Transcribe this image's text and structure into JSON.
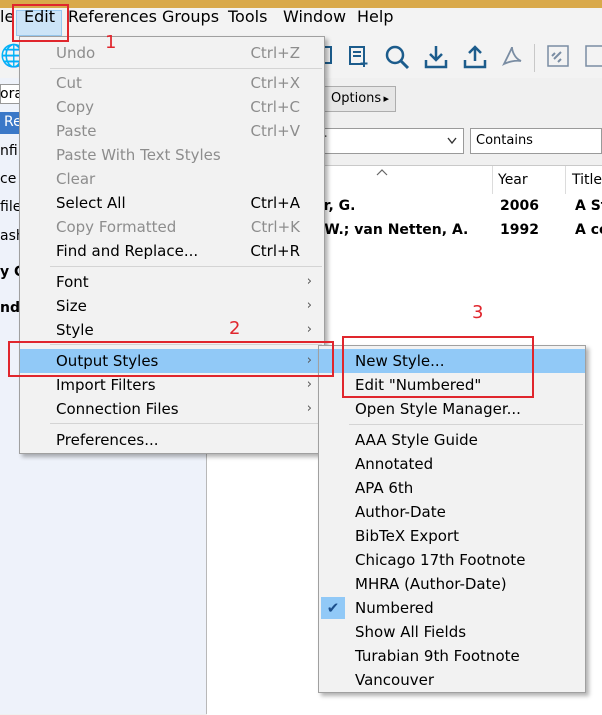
{
  "menubar": {
    "items": [
      "le",
      "Edit",
      "References",
      "Groups",
      "Tools",
      "Window",
      "Help"
    ]
  },
  "toolbar": {
    "icons": [
      "globe-icon",
      "copy-icon",
      "new-reference-icon",
      "online-search-icon",
      "import-icon",
      "export-icon",
      "pdf-icon",
      "link-icon",
      "share-icon"
    ]
  },
  "left_panel": {
    "fragments": [
      "ora",
      "Re",
      "nfi",
      "ce",
      "file",
      "ash",
      "y G",
      "nd"
    ]
  },
  "search": {
    "options_label": "Options",
    "options_arrow": "▸",
    "field_fragment": "r",
    "match_mode": "Contains"
  },
  "grid": {
    "headers": [
      "Year",
      "Title"
    ],
    "rows": [
      {
        "author": "or, G.",
        "year": "2006",
        "title": "A St"
      },
      {
        "author": ", W.; van Netten, A.",
        "year": "1992",
        "title": "A co"
      }
    ]
  },
  "edit_menu": {
    "items": [
      {
        "label": "Undo",
        "shortcut": "Ctrl+Z",
        "disabled": true
      },
      {
        "label": "Cut",
        "shortcut": "Ctrl+X",
        "disabled": true
      },
      {
        "label": "Copy",
        "shortcut": "Ctrl+C",
        "disabled": true
      },
      {
        "label": "Paste",
        "shortcut": "Ctrl+V",
        "disabled": true
      },
      {
        "label": "Paste With Text Styles",
        "shortcut": "",
        "disabled": true
      },
      {
        "label": "Clear",
        "shortcut": "",
        "disabled": true
      },
      {
        "label": "Select All",
        "shortcut": "Ctrl+A",
        "disabled": false
      },
      {
        "label": "Copy Formatted",
        "shortcut": "Ctrl+K",
        "disabled": true
      },
      {
        "label": "Find and Replace...",
        "shortcut": "Ctrl+R",
        "disabled": false
      },
      {
        "label": "Font",
        "shortcut": "",
        "disabled": false
      },
      {
        "label": "Size",
        "shortcut": "",
        "disabled": false
      },
      {
        "label": "Style",
        "shortcut": "",
        "disabled": false
      },
      {
        "label": "Output Styles",
        "shortcut": "",
        "disabled": false
      },
      {
        "label": "Import Filters",
        "shortcut": "",
        "disabled": false
      },
      {
        "label": "Connection Files",
        "shortcut": "",
        "disabled": false
      },
      {
        "label": "Preferences...",
        "shortcut": "",
        "disabled": false
      }
    ],
    "submenu_arrow": "›"
  },
  "styles_menu": {
    "items": [
      "New Style...",
      "Edit \"Numbered\"",
      "Open Style Manager...",
      "AAA Style Guide",
      "Annotated",
      "APA 6th",
      "Author-Date",
      "BibTeX Export",
      "Chicago 17th Footnote",
      "MHRA (Author-Date)",
      "Numbered",
      "Show All Fields",
      "Turabian 9th Footnote",
      "Vancouver"
    ],
    "checkmark": "✔"
  },
  "annotations": [
    "1",
    "2",
    "3"
  ],
  "colors": {
    "highlight": "#91c9f7",
    "annotation": "#e0262d",
    "selection": "#3a78c8"
  }
}
